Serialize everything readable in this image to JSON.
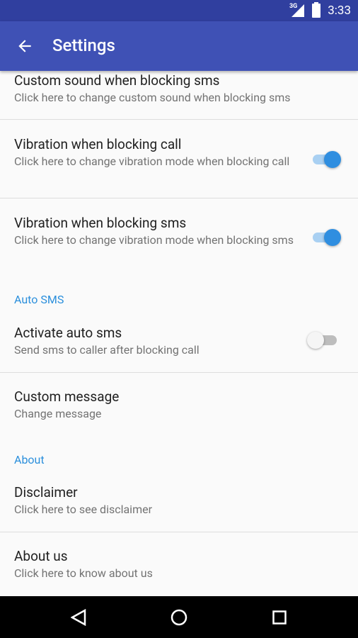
{
  "status": {
    "network": "3G",
    "time": "3:33"
  },
  "appbar": {
    "title": "Settings",
    "back_icon": "arrow-back-icon"
  },
  "colors": {
    "appbar": "#3f51b5",
    "status": "#303f9f",
    "accent": "#2f8ee0"
  },
  "items": [
    {
      "title": "Custom sound when blocking sms",
      "summary": "Click here to change custom sound when blocking sms"
    },
    {
      "title": "Vibration when blocking call",
      "summary": "Click here to change vibration mode when blocking call",
      "toggle": true
    },
    {
      "title": "Vibration when blocking sms",
      "summary": "Click here to change vibration mode when blocking sms",
      "toggle": true
    },
    {
      "title": "Activate auto sms",
      "summary": "Send sms to caller after blocking call",
      "toggle": false
    },
    {
      "title": "Custom message",
      "summary": "Change message"
    },
    {
      "title": "Disclaimer",
      "summary": "Click here to see disclaimer"
    },
    {
      "title": "About us",
      "summary": "Click here to know about us"
    }
  ],
  "categories": {
    "auto_sms": "Auto SMS",
    "about": "About"
  }
}
